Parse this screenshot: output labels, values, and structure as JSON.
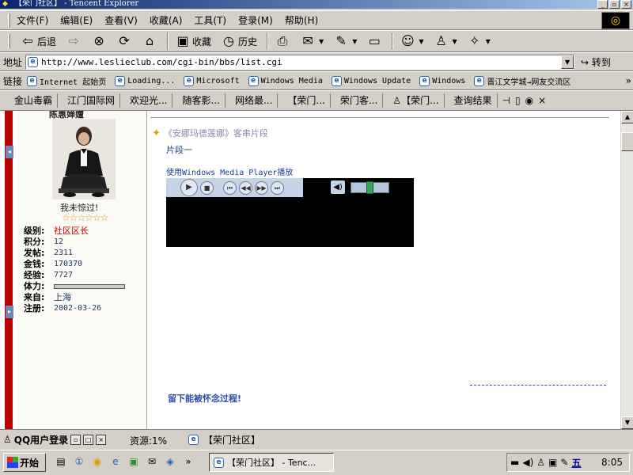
{
  "window": {
    "title": "【荣门社区】 - Tencent Explorer",
    "controls": [
      "_",
      "▫",
      "×"
    ]
  },
  "menu": {
    "items": [
      "文件(F)",
      "编辑(E)",
      "查看(V)",
      "收藏(A)",
      "工具(T)",
      "登录(M)",
      "帮助(H)"
    ]
  },
  "toolbar": {
    "back": "后退",
    "favorites": "收藏",
    "history": "历史"
  },
  "address": {
    "label": "地址",
    "url": "http://www.leslieclub.com/cgi-bin/bbs/list.cgi",
    "go": "转到"
  },
  "links": {
    "label": "链接",
    "items": [
      "Internet 起始页",
      "Loading...",
      "Microsoft",
      "Windows Media",
      "Windows Update",
      "Windows",
      "晋江文学城→网友交流区"
    ],
    "more": "»"
  },
  "tabs": {
    "items": [
      "金山毒霸",
      "江门国际网",
      "欢迎光...",
      "随客影...",
      "网络最...",
      "【荣门...",
      "荣门客...",
      "【荣门...",
      "查询结果"
    ]
  },
  "profile": {
    "name": "陈惠婵嬗",
    "slogan": "我未惊过!",
    "stars": "☆☆☆☆☆☆",
    "rank_key": "级别:",
    "rank_val": "社区区长",
    "points_key": "积分:",
    "points_val": "12",
    "posts_key": "发帖:",
    "posts_val": "2311",
    "money_key": "金钱:",
    "money_val": "170370",
    "exp_key": "经验:",
    "exp_val": "7727",
    "stamina_key": "体力:",
    "from_key": "来自:",
    "from_val": "上海",
    "reg_key": "注册:",
    "reg_val": "2002-03-26"
  },
  "post": {
    "title": "《安娜玛德莲娜》客串片段",
    "segment": "片段一",
    "player_label": "使用Windows Media Player播放",
    "volume": 0.5,
    "footer": "留下能被怀念过程!"
  },
  "status": {
    "qq_title": "QQ用户登录",
    "resource": "资源:1%",
    "page": "【荣门社区】"
  },
  "taskbar": {
    "start": "开始",
    "task": "【荣门社区】 - Tenc...",
    "tray_lang": "五",
    "clock": "8:05"
  }
}
